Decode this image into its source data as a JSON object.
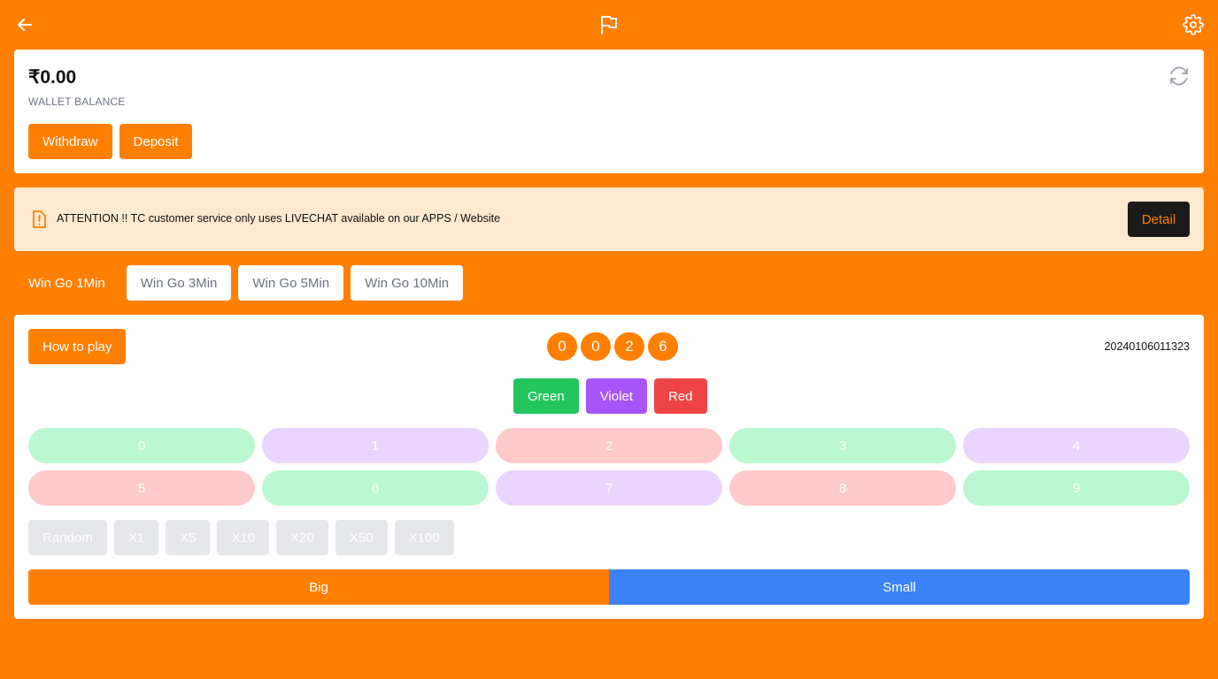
{
  "topbar": {
    "back_icon": "arrow-left-icon",
    "flag_icon": "flag-icon",
    "settings_icon": "gear-icon"
  },
  "wallet": {
    "balance": "₹0.00",
    "label": "WALLET BALANCE",
    "withdraw_label": "Withdraw",
    "deposit_label": "Deposit",
    "refresh_icon": "refresh-icon"
  },
  "notice": {
    "icon": "alert-icon",
    "text": "ATTENTION !! TC customer service only uses LIVECHAT available on our APPS / Website",
    "detail_label": "Detail"
  },
  "tabs": [
    {
      "label": "Win Go 1Min",
      "active": true
    },
    {
      "label": "Win Go 3Min",
      "active": false
    },
    {
      "label": "Win Go 5Min",
      "active": false
    },
    {
      "label": "Win Go 10Min",
      "active": false
    }
  ],
  "game": {
    "how_to_play_label": "How to play",
    "countdown": [
      "0",
      "0",
      "2",
      "6"
    ],
    "period": "20240106011323",
    "colors": [
      {
        "label": "Green",
        "color": "#22c55e"
      },
      {
        "label": "Violet",
        "color": "#a855f7"
      },
      {
        "label": "Red",
        "color": "#ef4444"
      }
    ],
    "numbers": [
      {
        "label": "0",
        "color": "#bbf7d0"
      },
      {
        "label": "1",
        "color": "#e9d5ff"
      },
      {
        "label": "2",
        "color": "#fecaca"
      },
      {
        "label": "3",
        "color": "#bbf7d0"
      },
      {
        "label": "4",
        "color": "#e9d5ff"
      },
      {
        "label": "5",
        "color": "#fecaca"
      },
      {
        "label": "6",
        "color": "#bbf7d0"
      },
      {
        "label": "7",
        "color": "#e9d5ff"
      },
      {
        "label": "8",
        "color": "#fecaca"
      },
      {
        "label": "9",
        "color": "#bbf7d0"
      }
    ],
    "multipliers": [
      "Random",
      "X1",
      "X5",
      "X10",
      "X20",
      "X50",
      "X100"
    ],
    "big_label": "Big",
    "big_color": "#ff7f00",
    "small_label": "Small",
    "small_color": "#3b82f6"
  },
  "colors": {
    "accent": "#ff7f00",
    "notice_bg": "#fde9cf",
    "detail_bg": "#1a1a1a"
  }
}
